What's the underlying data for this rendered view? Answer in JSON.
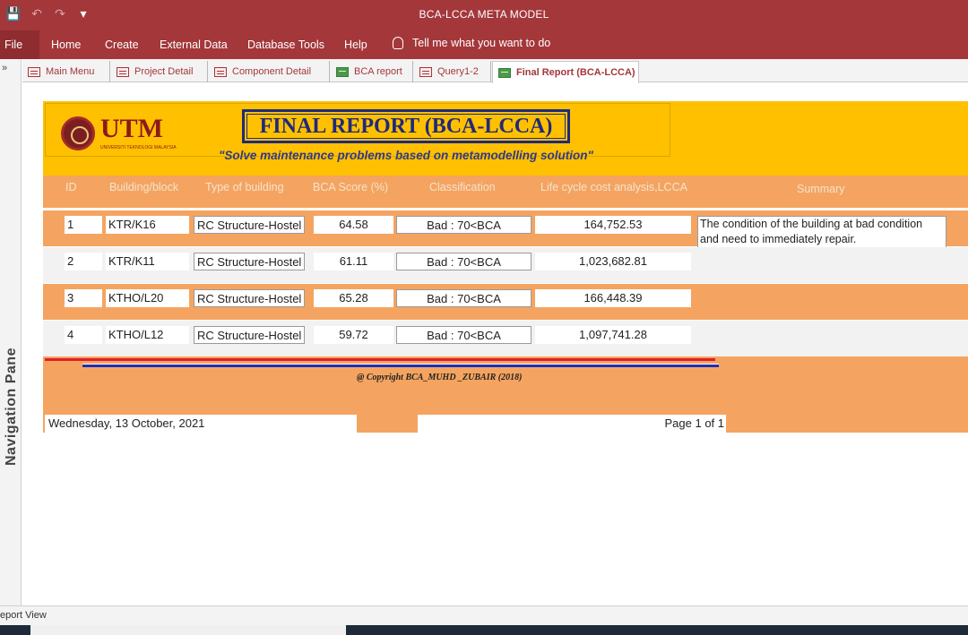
{
  "window": {
    "title": "BCA-LCCA META MODEL"
  },
  "qat": {
    "save_icon": "save-icon",
    "undo_icon": "undo-icon",
    "redo_icon": "redo-icon",
    "customize_icon": "customize-icon"
  },
  "ribbon": {
    "file": "File",
    "menus": [
      "Home",
      "Create",
      "External Data",
      "Database Tools",
      "Help"
    ],
    "tell_me": "Tell me what you want to do"
  },
  "nav_pane": {
    "label": "Navigation Pane",
    "toggle": "»"
  },
  "tabs": [
    {
      "label": "Main Menu",
      "icon": "form-icon"
    },
    {
      "label": "Project Detail",
      "icon": "form-icon"
    },
    {
      "label": "Component Detail",
      "icon": "form-icon"
    },
    {
      "label": "BCA report",
      "icon": "report-icon"
    },
    {
      "label": "Query1-2",
      "icon": "query-icon"
    },
    {
      "label": "Final Report (BCA-LCCA)",
      "icon": "report-icon"
    }
  ],
  "report": {
    "logo_text": "UTM",
    "logo_sub": "UNIVERSITI TEKNOLOGI MALAYSIA",
    "title": "FINAL REPORT (BCA-LCCA)",
    "tagline": "\"Solve maintenance problems based on metamodelling solution\"",
    "columns": [
      "ID",
      "Building/block",
      "Type of building",
      "BCA Score (%)",
      "Classification",
      "Life cycle cost analysis,LCCA",
      "Summary"
    ],
    "rows": [
      {
        "id": "1",
        "block": "KTR/K16",
        "type": "RC Structure-Hostel",
        "score": "64.58",
        "class": "Bad : 70<BCA",
        "lcca": "164,752.53"
      },
      {
        "id": "2",
        "block": "KTR/K11",
        "type": "RC Structure-Hostel",
        "score": "61.11",
        "class": "Bad : 70<BCA",
        "lcca": "1,023,682.81"
      },
      {
        "id": "3",
        "block": "KTHO/L20",
        "type": "RC Structure-Hostel",
        "score": "65.28",
        "class": "Bad : 70<BCA",
        "lcca": "166,448.39"
      },
      {
        "id": "4",
        "block": "KTHO/L12",
        "type": "RC Structure-Hostel",
        "score": "59.72",
        "class": "Bad : 70<BCA",
        "lcca": "1,097,741.28"
      }
    ],
    "summary": "The condition of the building at bad condition and need to immediately repair.",
    "copyright": "@ Copyright BCA_MUHD _ZUBAIR (2018)",
    "date": "Wednesday, 13 October, 2021",
    "page": "Page 1 of 1"
  },
  "status": {
    "view": "eport View"
  },
  "colors": {
    "accent": "#a4373a",
    "header": "#ffc000",
    "band": "#f4a460",
    "title_blue": "#1f2a7a"
  }
}
